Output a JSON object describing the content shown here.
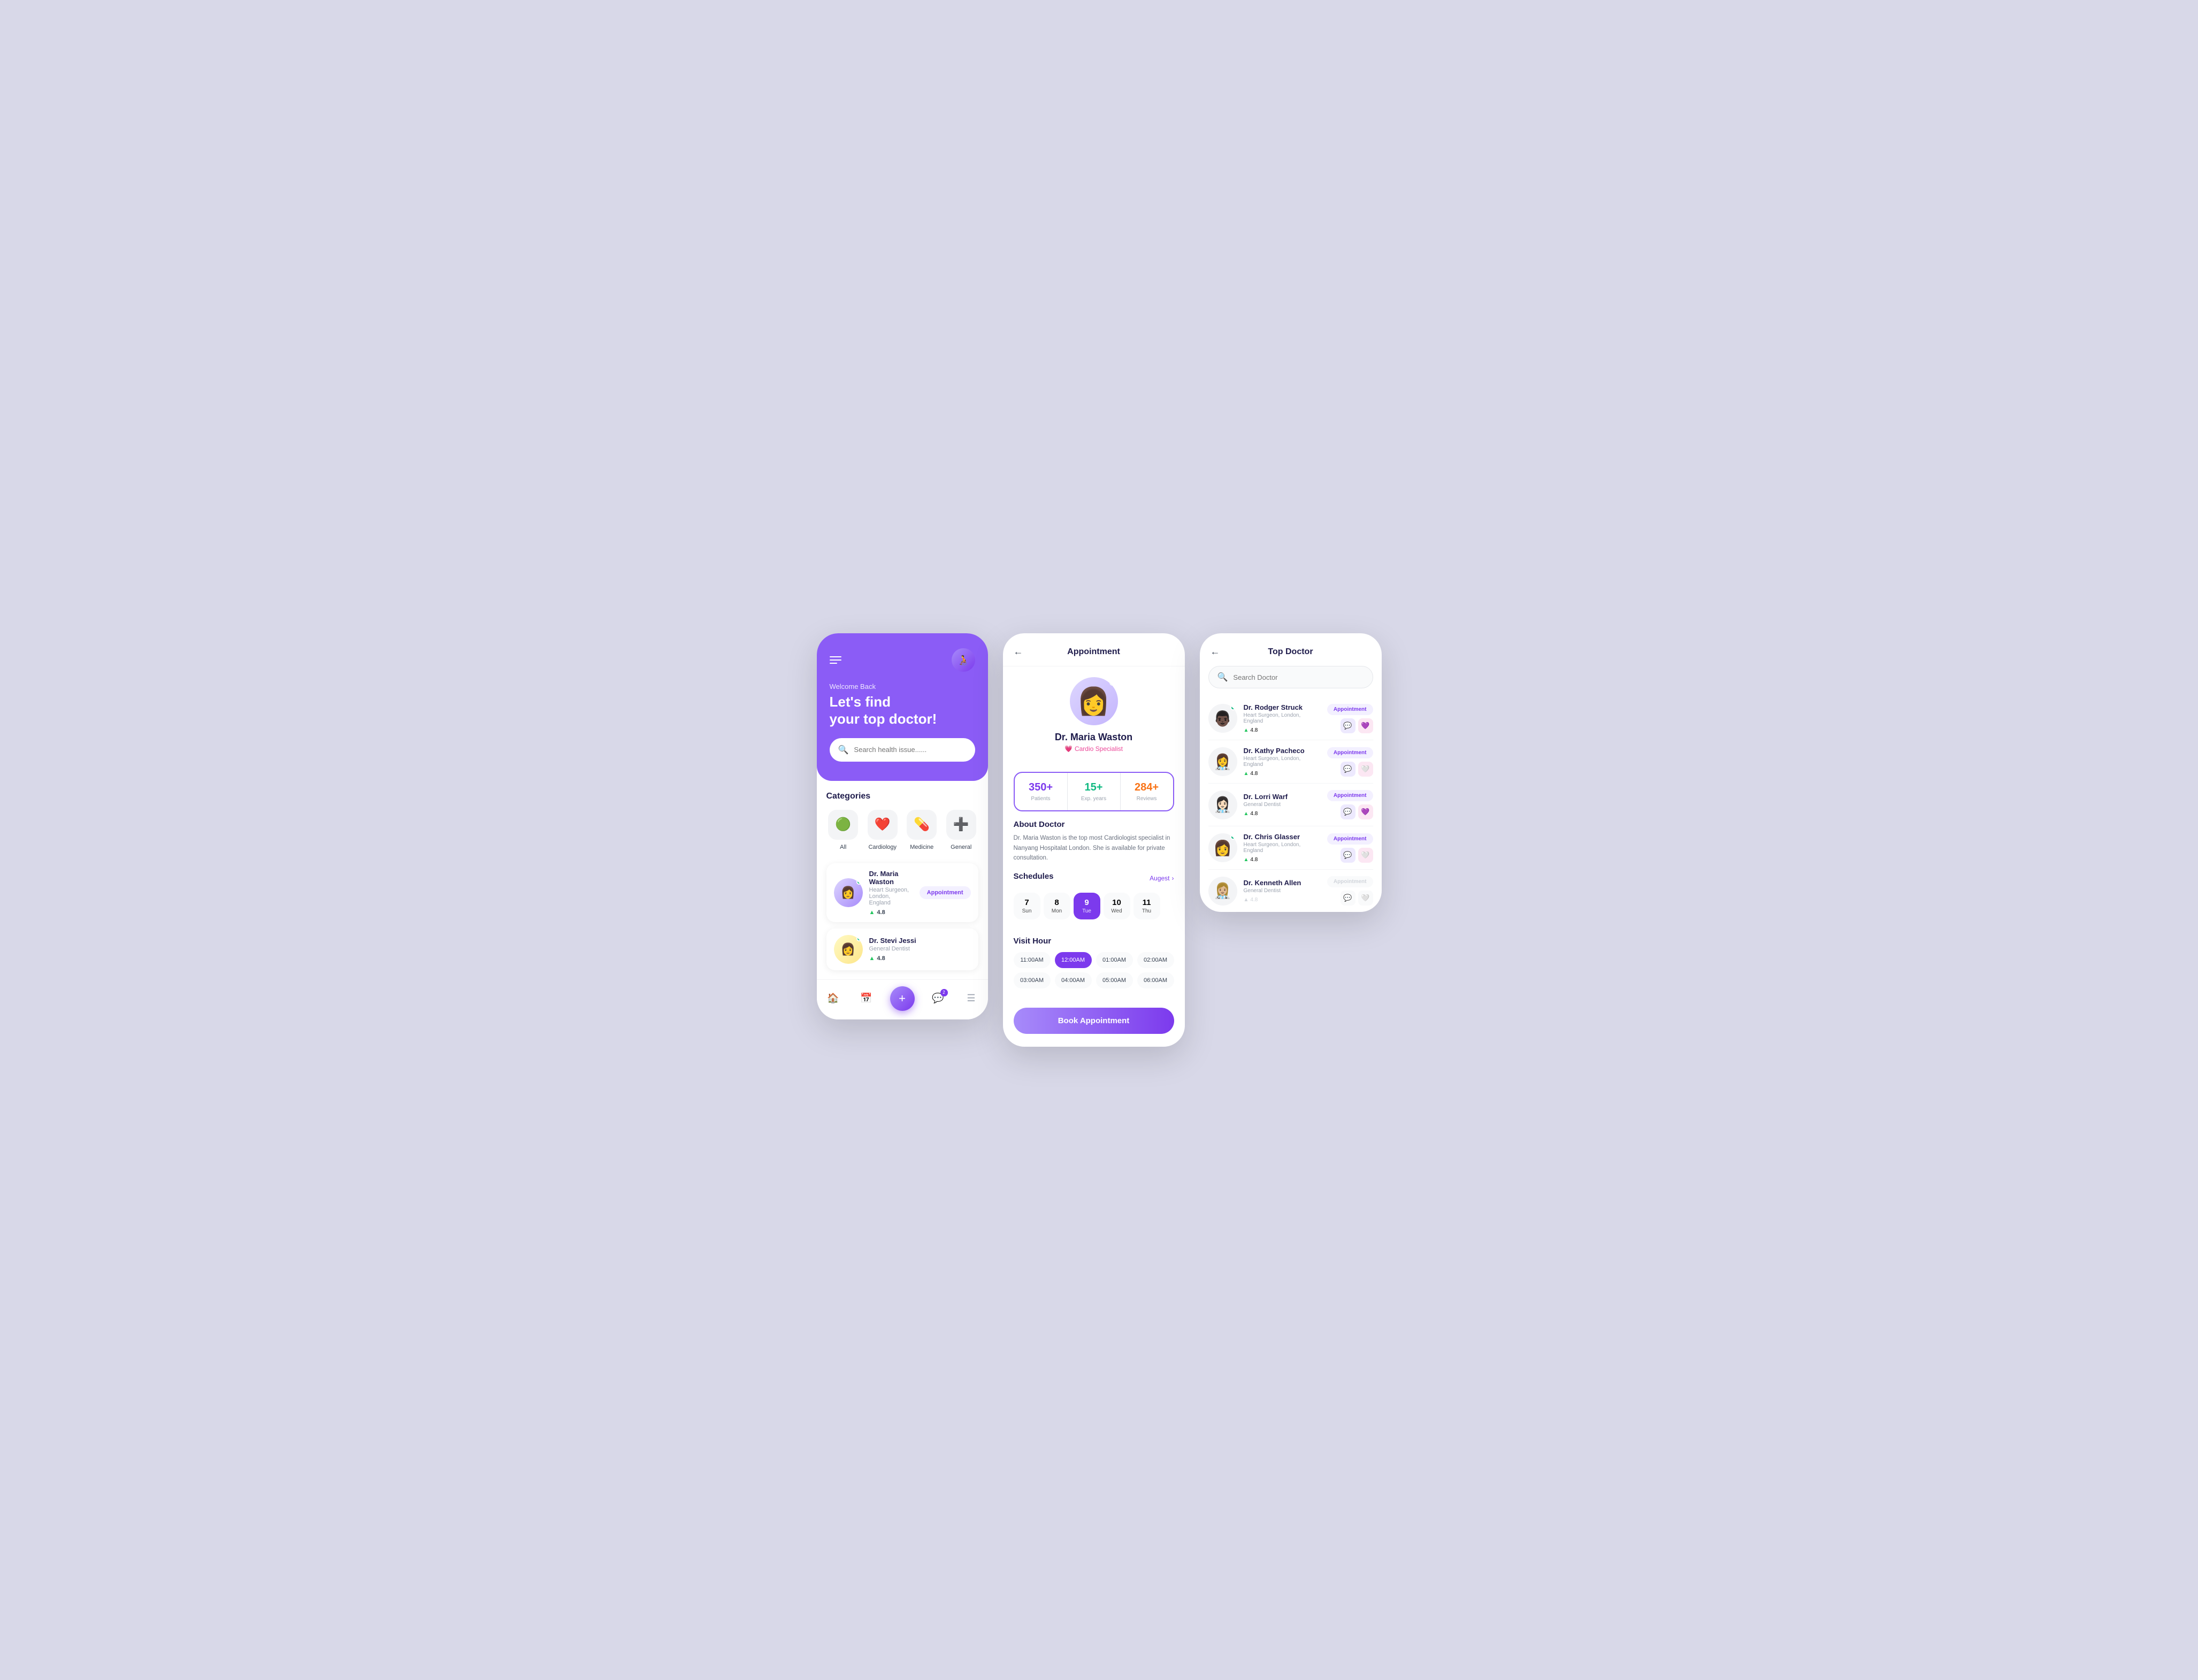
{
  "background": "#d4d4e8",
  "screen1": {
    "welcome": "Welcome Back",
    "title_line1": "Let's find",
    "title_line2": "your top doctor!",
    "search_placeholder": "Search health issue......",
    "categories_title": "Categories",
    "categories": [
      {
        "label": "All",
        "icon": "🟢"
      },
      {
        "label": "Cardiology",
        "icon": "❤️"
      },
      {
        "label": "Medicine",
        "icon": "💊"
      },
      {
        "label": "General",
        "icon": "➕"
      }
    ],
    "doctors": [
      {
        "name": "Dr. Maria Waston",
        "spec": "Heart Surgeon, London, England",
        "rating": "4.8",
        "online": true,
        "icon": "👩‍⚕️"
      },
      {
        "name": "Dr. Stevi Jessi",
        "spec": "General Dentist",
        "rating": "4.8",
        "online": true,
        "icon": "👩"
      }
    ],
    "appointment_btn": "Appointment",
    "nav": {
      "home_icon": "🏠",
      "calendar_icon": "📅",
      "chat_icon": "💬",
      "add_icon": "+",
      "badge": "2"
    }
  },
  "screen2": {
    "title": "Appointment",
    "back_icon": "←",
    "doctor_name": "Dr. Maria Waston",
    "doctor_spec": "Cardio Specialist",
    "stats": [
      {
        "value": "350+",
        "label": "Patients",
        "color": "purple"
      },
      {
        "value": "15+",
        "label": "Exp. years",
        "color": "green"
      },
      {
        "value": "284+",
        "label": "Reviews",
        "color": "orange"
      }
    ],
    "about_title": "About Doctor",
    "about_text": "Dr. Maria Waston is the top most Cardiologist specialist in Nanyang Hospitalat London. She is available for private consultation.",
    "schedules_title": "Schedules",
    "month": "Augest",
    "dates": [
      {
        "num": "7",
        "day": "Sun",
        "active": false
      },
      {
        "num": "8",
        "day": "Mon",
        "active": false
      },
      {
        "num": "9",
        "day": "Tue",
        "active": true
      },
      {
        "num": "10",
        "day": "Wed",
        "active": false
      },
      {
        "num": "11",
        "day": "Thu",
        "active": false
      }
    ],
    "visit_hour_title": "Visit Hour",
    "times": [
      {
        "label": "11:00AM",
        "active": false
      },
      {
        "label": "12:00AM",
        "active": true
      },
      {
        "label": "01:00AM",
        "active": false
      },
      {
        "label": "02:00AM",
        "active": false
      },
      {
        "label": "03:00AM",
        "active": false
      },
      {
        "label": "04:00AM",
        "active": false
      },
      {
        "label": "05:00AM",
        "active": false
      },
      {
        "label": "06:00AM",
        "active": false
      }
    ],
    "book_btn": "Book Appointment"
  },
  "screen3": {
    "title": "Top Doctor",
    "back_icon": "←",
    "search_placeholder": "Search Doctor",
    "doctors": [
      {
        "name": "Dr. Rodger Struck",
        "spec": "Heart Surgeon, London, England",
        "rating": "4.8",
        "online": true,
        "icon": "👨🏿‍⚕️",
        "appt_active": true,
        "heart_active": true
      },
      {
        "name": "Dr. Kathy Pacheco",
        "spec": "Heart Surgeon, London, England",
        "rating": "4.8",
        "online": false,
        "icon": "👩‍⚕️",
        "appt_active": true,
        "heart_active": false
      },
      {
        "name": "Dr. Lorri Warf",
        "spec": "General Dentist",
        "rating": "4.8",
        "online": false,
        "icon": "👩🏻‍⚕️",
        "appt_active": true,
        "heart_active": true
      },
      {
        "name": "Dr. Chris Glasser",
        "spec": "Heart Surgeon, London, England",
        "rating": "4.8",
        "online": true,
        "icon": "👩‍⚕️",
        "appt_active": true,
        "heart_active": false
      },
      {
        "name": "Dr. Kenneth Allen",
        "spec": "General Dentist",
        "rating": "4.8",
        "online": false,
        "icon": "👩🏼‍⚕️",
        "appt_active": false,
        "heart_active": false
      }
    ]
  }
}
